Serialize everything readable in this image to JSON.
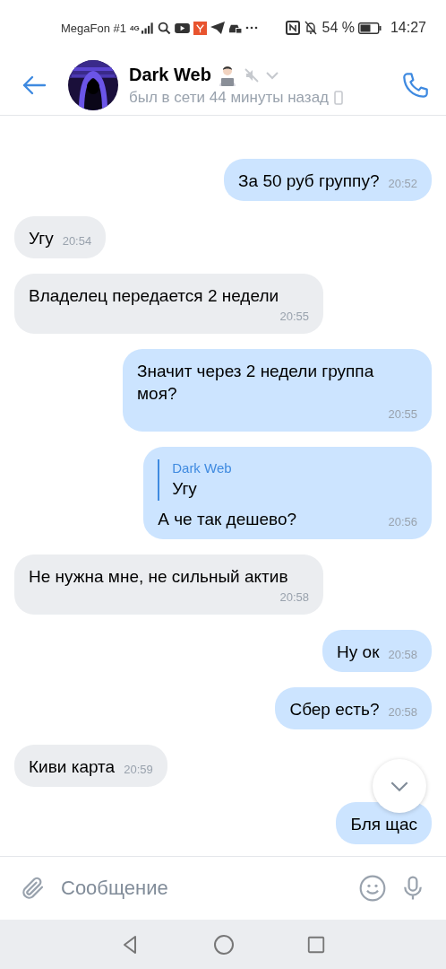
{
  "status_bar": {
    "carrier": "MegaFon #1",
    "network": "4G",
    "battery": "54 %",
    "time": "14:27"
  },
  "header": {
    "name": "Dark Web",
    "muted": true,
    "last_seen": "был в сети 44 минуты назад"
  },
  "messages": [
    {
      "outgoing": true,
      "text": "За 50 руб группу?",
      "time": "20:52"
    },
    {
      "outgoing": false,
      "text": "Угу",
      "time": "20:54"
    },
    {
      "outgoing": false,
      "text": "Владелец передается 2 недели",
      "time": "20:55"
    },
    {
      "outgoing": true,
      "text": "Значит через 2 недели группа моя?",
      "time": "20:55"
    },
    {
      "outgoing": true,
      "reply": {
        "author": "Dark Web",
        "text": "Угу"
      },
      "text": "А че так дешево?",
      "time": "20:56"
    },
    {
      "outgoing": false,
      "text": "Не нужна мне, не сильный актив",
      "time": "20:58"
    },
    {
      "outgoing": true,
      "text": "Ну ок",
      "time": "20:58"
    },
    {
      "outgoing": true,
      "text": "Сбер есть?",
      "time": "20:58"
    },
    {
      "outgoing": false,
      "text": "Киви карта",
      "time": "20:59"
    },
    {
      "outgoing": true,
      "text": "Бля щас"
    }
  ],
  "composer": {
    "placeholder": "Сообщение"
  }
}
